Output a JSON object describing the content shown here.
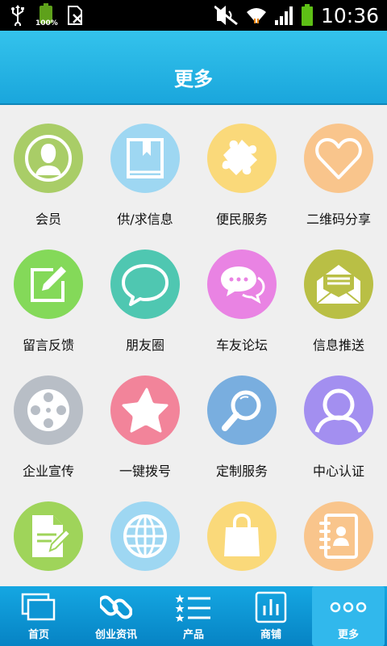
{
  "status_bar": {
    "time": "10:36",
    "battery_percent": "100%",
    "icons": [
      "usb-icon",
      "battery-full-icon",
      "sim-icon",
      "mute-icon",
      "wifi-icon",
      "signal-icon",
      "battery-icon"
    ]
  },
  "header": {
    "title": "更多"
  },
  "grid": {
    "items": [
      {
        "label": "会员",
        "icon": "member-icon",
        "color": "#a9cd67"
      },
      {
        "label": "供/求信息",
        "icon": "book-icon",
        "color": "#9ed7f2"
      },
      {
        "label": "便民服务",
        "icon": "puzzle-icon",
        "color": "#fad97a"
      },
      {
        "label": "二维码分享",
        "icon": "heart-icon",
        "color": "#f9c58c"
      },
      {
        "label": "留言反馈",
        "icon": "edit-icon",
        "color": "#84d959"
      },
      {
        "label": "朋友圈",
        "icon": "chat-bubble-icon",
        "color": "#4fc7b1"
      },
      {
        "label": "车友论坛",
        "icon": "forum-chat-icon",
        "color": "#e983e3"
      },
      {
        "label": "信息推送",
        "icon": "mail-icon",
        "color": "#b9bf45"
      },
      {
        "label": "企业宣传",
        "icon": "film-reel-icon",
        "color": "#b8bec6"
      },
      {
        "label": "一键拨号",
        "icon": "star-icon",
        "color": "#f2849a"
      },
      {
        "label": "定制服务",
        "icon": "search-icon",
        "color": "#79aedf"
      },
      {
        "label": "中心认证",
        "icon": "user-icon",
        "color": "#a38ff0"
      },
      {
        "label": "",
        "icon": "document-edit-icon",
        "color": "#9fd45a"
      },
      {
        "label": "",
        "icon": "globe-icon",
        "color": "#9ed7f2"
      },
      {
        "label": "",
        "icon": "shopping-bag-icon",
        "color": "#fad97a"
      },
      {
        "label": "",
        "icon": "contacts-book-icon",
        "color": "#f9c58c"
      }
    ]
  },
  "tabbar": {
    "items": [
      {
        "label": "首页",
        "icon": "windows-icon"
      },
      {
        "label": "创业资讯",
        "icon": "link-icon"
      },
      {
        "label": "产品",
        "icon": "list-icon"
      },
      {
        "label": "商铺",
        "icon": "bar-chart-icon"
      },
      {
        "label": "更多",
        "icon": "more-dots-icon",
        "active": true
      }
    ]
  }
}
